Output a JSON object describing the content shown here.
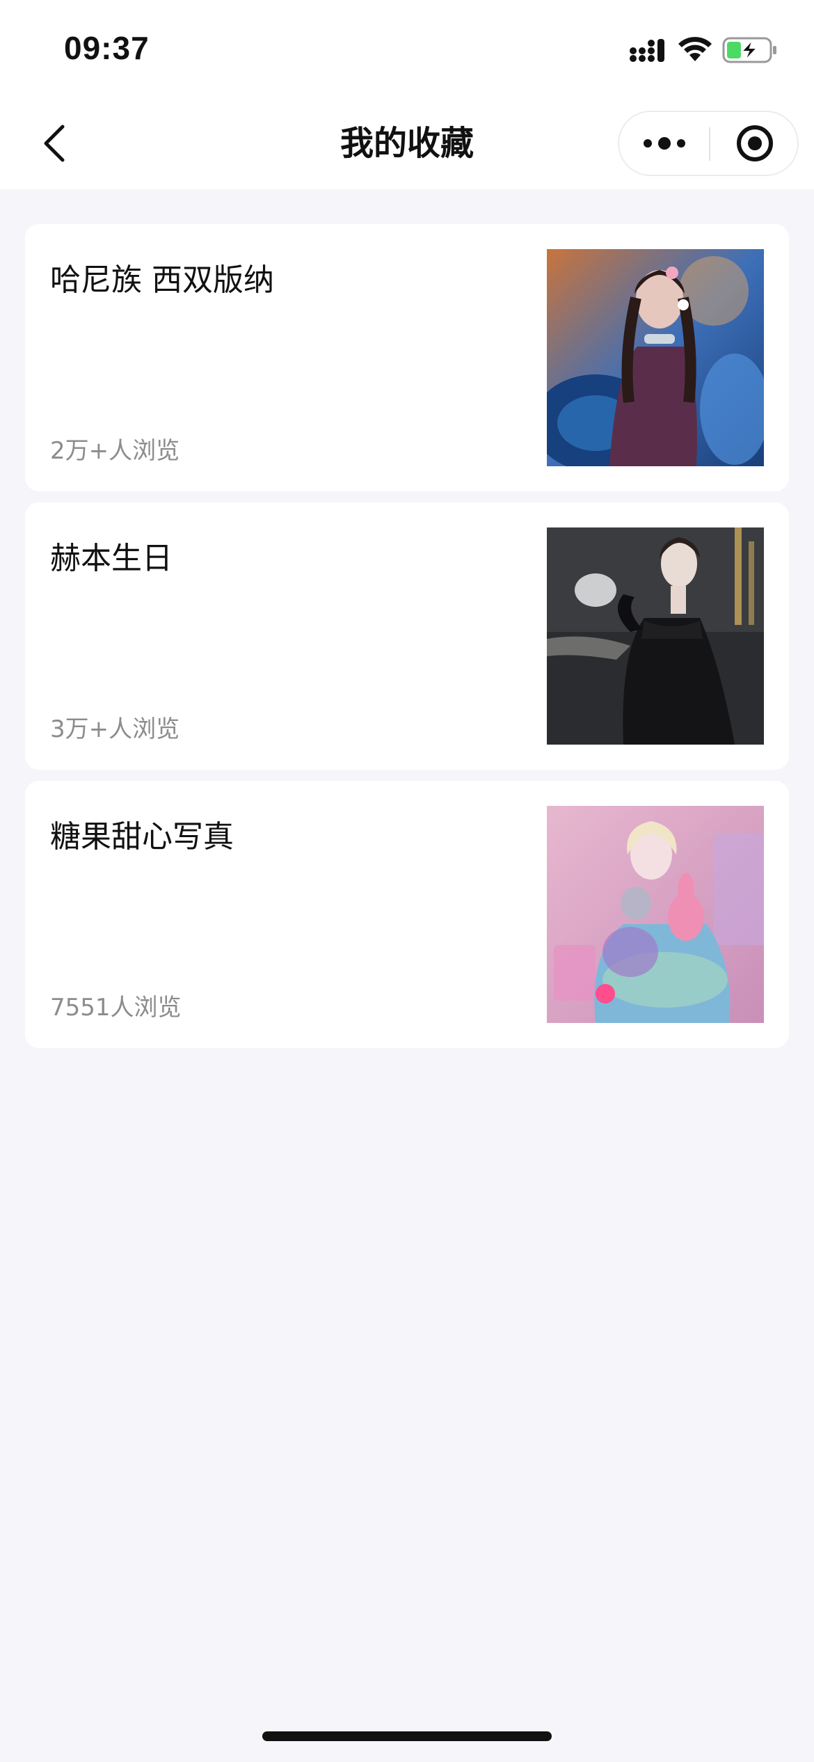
{
  "status_bar": {
    "time": "09:37",
    "icons": [
      "signal-icon",
      "wifi-icon",
      "battery-charging-icon"
    ],
    "battery_color": "#4cd964"
  },
  "nav": {
    "title": "我的收藏",
    "icons": [
      "back-chevron-icon",
      "more-dots-icon",
      "close-target-icon"
    ]
  },
  "favorites": [
    {
      "title": "哈尼族 西双版纳",
      "views": "2万+人浏览",
      "thumb_palette": [
        "#1a3f7a",
        "#c9743c",
        "#3d6fb8",
        "#e6c7bd"
      ]
    },
    {
      "title": "赫本生日",
      "views": "3万+人浏览",
      "thumb_palette": [
        "#3a3c40",
        "#222",
        "#8a8a85",
        "#c9a85a"
      ]
    },
    {
      "title": "糖果甜心写真",
      "views": "7551人浏览",
      "thumb_palette": [
        "#d99bbf",
        "#7fb7d9",
        "#f0c9dc",
        "#9f7bc9"
      ]
    }
  ]
}
